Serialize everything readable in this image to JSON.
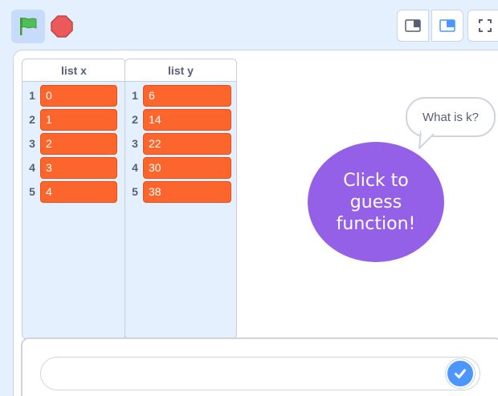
{
  "controls": {
    "green_flag_icon": "green-flag-icon",
    "stop_icon": "stop-sign-icon",
    "small_stage_icon": "small-stage-icon",
    "large_stage_icon": "large-stage-icon",
    "fullscreen_icon": "fullscreen-icon"
  },
  "lists": [
    {
      "name": "list x",
      "items": [
        {
          "index": "1",
          "value": "0"
        },
        {
          "index": "2",
          "value": "1"
        },
        {
          "index": "3",
          "value": "2"
        },
        {
          "index": "4",
          "value": "3"
        },
        {
          "index": "5",
          "value": "4"
        }
      ]
    },
    {
      "name": "list y",
      "items": [
        {
          "index": "1",
          "value": "6"
        },
        {
          "index": "2",
          "value": "14"
        },
        {
          "index": "3",
          "value": "22"
        },
        {
          "index": "4",
          "value": "30"
        },
        {
          "index": "5",
          "value": "38"
        }
      ]
    }
  ],
  "speech_bubble": "What is k?",
  "sprite": {
    "line1": "Click to",
    "line2": "guess",
    "line3": "function!"
  },
  "ask": {
    "value": "",
    "submit_icon": "checkmark-icon"
  },
  "colors": {
    "list_item": "#fc662c",
    "sprite": "#9560e8",
    "submit": "#4c97ff",
    "flag": "#4cbf56",
    "stop": "#ec5959"
  }
}
